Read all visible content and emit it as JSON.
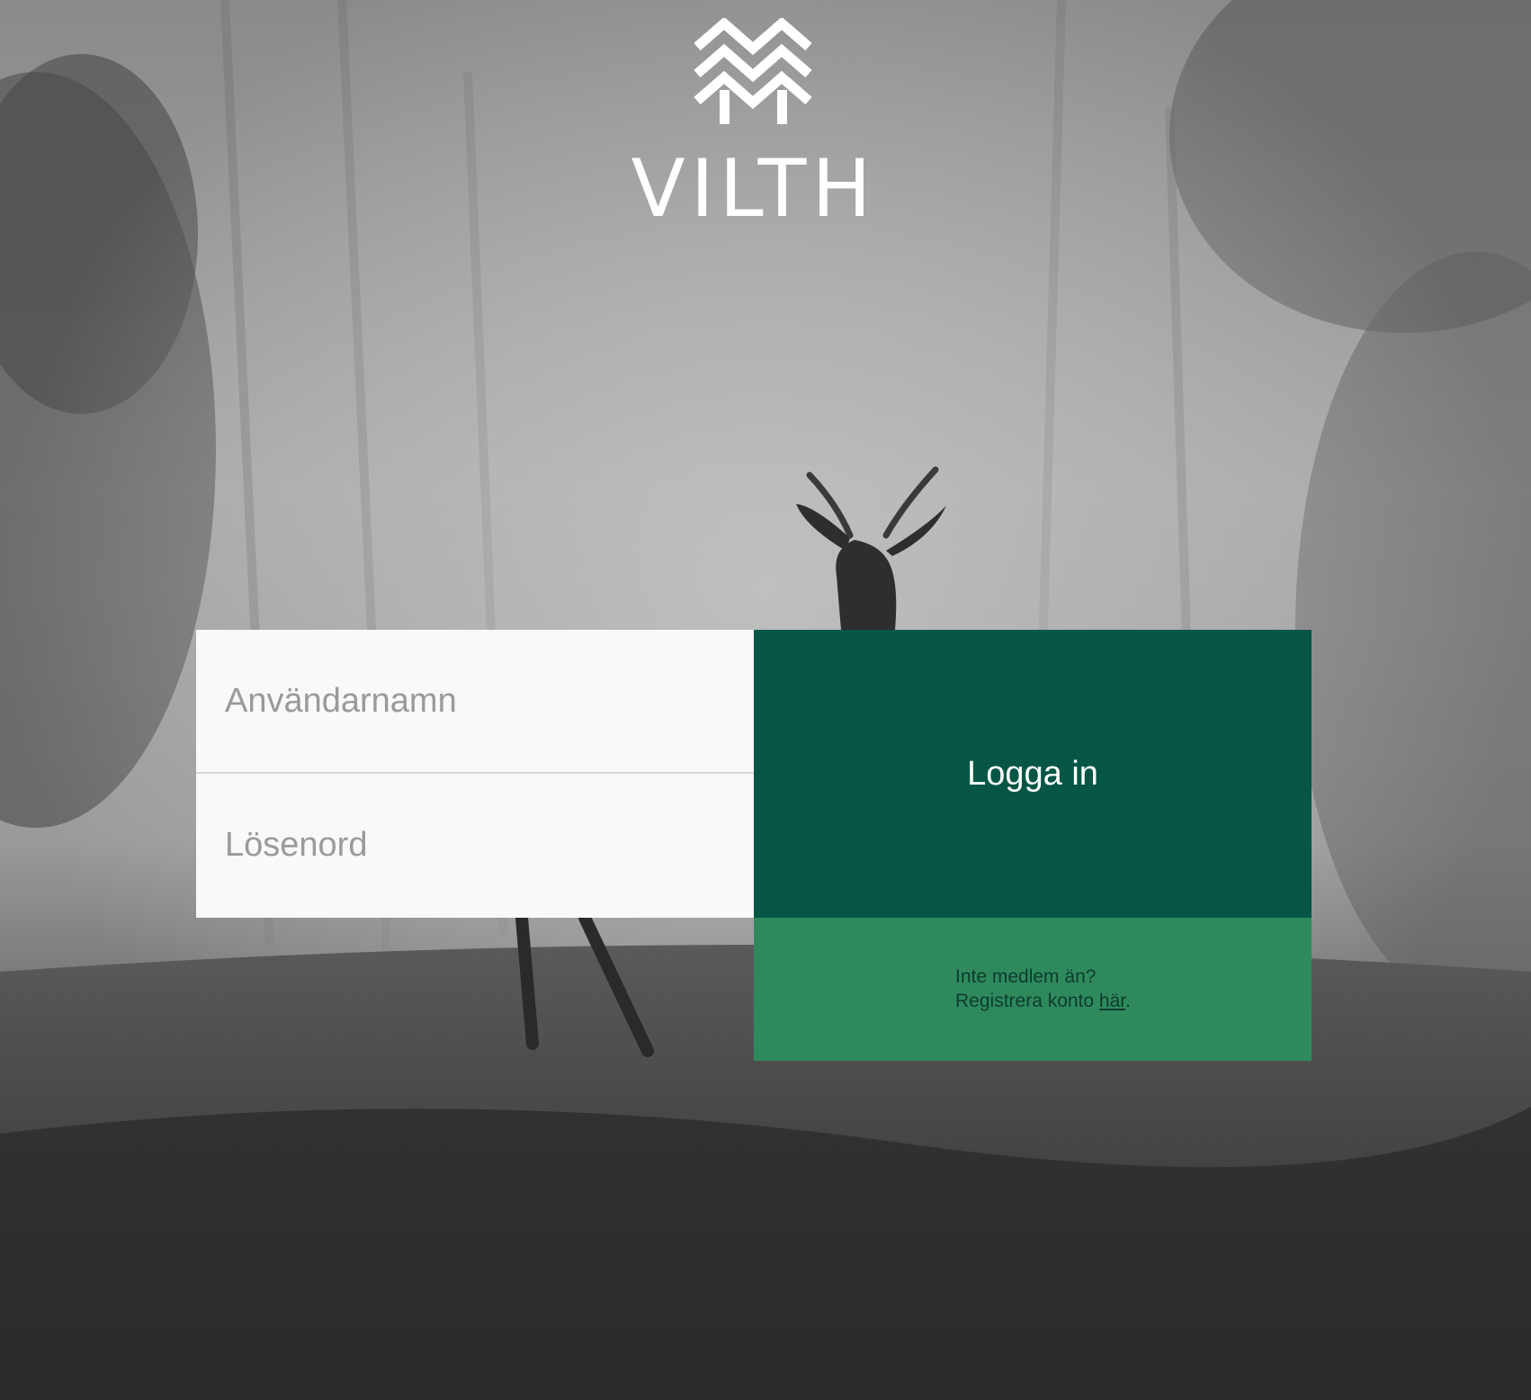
{
  "brand": {
    "name": "VILTH",
    "logo_icon": "mountain-chevrons-icon"
  },
  "login": {
    "username_placeholder": "Användarnamn",
    "password_placeholder": "Lösenord",
    "submit_label": "Logga in"
  },
  "register": {
    "line1": "Inte medlem än?",
    "line2_prefix": "Registrera konto ",
    "link_label": "här",
    "line2_suffix": "."
  },
  "colors": {
    "button_bg": "#055645",
    "register_bg": "#2e8a5c",
    "input_bg": "#f9f9f9"
  }
}
